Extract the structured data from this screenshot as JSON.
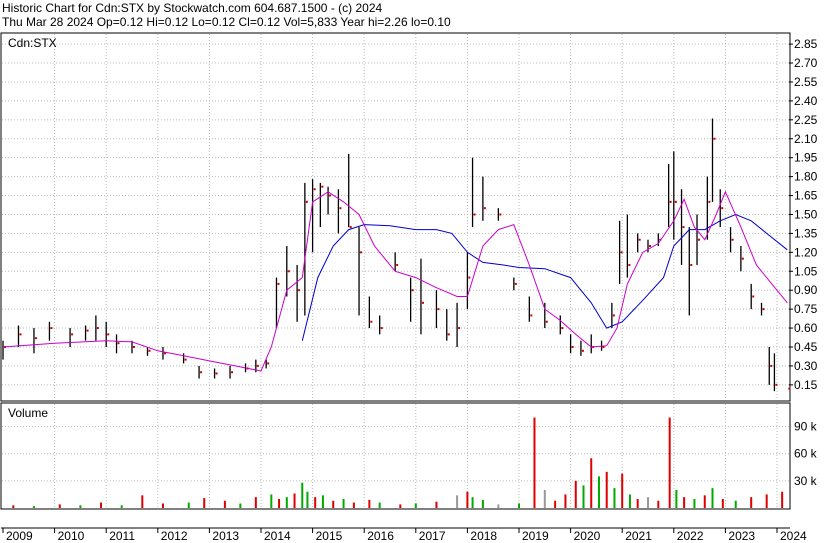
{
  "header": {
    "line1": "Historic Chart for Cdn:STX by Stockwatch.com 604.687.1500 - (c) 2024",
    "line2": "Thu Mar 28 2024  Op=0.12  Hi=0.12  Lo=0.12  Cl=0.12  Vol=5,833  Year hi=2.26  lo=0.10"
  },
  "colors": {
    "price_bar": "#000000",
    "close_dot": "#cc0000",
    "ma_short": "#cc00cc",
    "ma_long": "#0000cc",
    "vol_up": "#00aa00",
    "vol_down": "#dd0000",
    "vol_flat": "#999999"
  },
  "chart_data": {
    "type": "line",
    "symbol_label": "Cdn:STX",
    "volume_label": "Volume",
    "x_tick_labels": [
      "2009",
      "2010",
      "2011",
      "2012",
      "2013",
      "2014",
      "2015",
      "2016",
      "2017",
      "2018",
      "2019",
      "2020",
      "2021",
      "2022",
      "2023",
      "2024"
    ],
    "price_axis": {
      "min": 0.03,
      "max": 2.93,
      "ticks": [
        0.15,
        0.3,
        0.45,
        0.6,
        0.75,
        0.9,
        1.05,
        1.2,
        1.35,
        1.5,
        1.65,
        1.8,
        1.95,
        2.1,
        2.25,
        2.4,
        2.55,
        2.7,
        2.85
      ]
    },
    "volume_axis": {
      "min": 0,
      "max": 115000,
      "ticks": [
        30000,
        60000,
        90000
      ],
      "tick_labels": [
        "30 k",
        "60 k",
        "90 k"
      ]
    },
    "price_series": [
      {
        "t": 2009.0,
        "hi": 0.5,
        "lo": 0.35,
        "c": 0.45
      },
      {
        "t": 2009.3,
        "hi": 0.62,
        "lo": 0.45,
        "c": 0.55
      },
      {
        "t": 2009.6,
        "hi": 0.6,
        "lo": 0.4,
        "c": 0.52
      },
      {
        "t": 2009.9,
        "hi": 0.65,
        "lo": 0.5,
        "c": 0.6
      },
      {
        "t": 2010.3,
        "hi": 0.6,
        "lo": 0.45,
        "c": 0.55
      },
      {
        "t": 2010.6,
        "hi": 0.62,
        "lo": 0.5,
        "c": 0.58
      },
      {
        "t": 2010.8,
        "hi": 0.7,
        "lo": 0.5,
        "c": 0.6
      },
      {
        "t": 2011.0,
        "hi": 0.65,
        "lo": 0.45,
        "c": 0.55
      },
      {
        "t": 2011.2,
        "hi": 0.55,
        "lo": 0.4,
        "c": 0.48
      },
      {
        "t": 2011.5,
        "hi": 0.5,
        "lo": 0.4,
        "c": 0.45
      },
      {
        "t": 2011.8,
        "hi": 0.45,
        "lo": 0.38,
        "c": 0.42
      },
      {
        "t": 2012.1,
        "hi": 0.45,
        "lo": 0.35,
        "c": 0.4
      },
      {
        "t": 2012.5,
        "hi": 0.4,
        "lo": 0.32,
        "c": 0.35
      },
      {
        "t": 2012.8,
        "hi": 0.3,
        "lo": 0.2,
        "c": 0.25
      },
      {
        "t": 2013.1,
        "hi": 0.28,
        "lo": 0.2,
        "c": 0.24
      },
      {
        "t": 2013.4,
        "hi": 0.3,
        "lo": 0.2,
        "c": 0.25
      },
      {
        "t": 2013.7,
        "hi": 0.32,
        "lo": 0.25,
        "c": 0.28
      },
      {
        "t": 2013.9,
        "hi": 0.35,
        "lo": 0.25,
        "c": 0.3
      },
      {
        "t": 2014.1,
        "hi": 0.35,
        "lo": 0.28,
        "c": 0.32
      },
      {
        "t": 2014.3,
        "hi": 1.0,
        "lo": 0.6,
        "c": 0.95
      },
      {
        "t": 2014.5,
        "hi": 1.25,
        "lo": 0.85,
        "c": 1.05
      },
      {
        "t": 2014.7,
        "hi": 1.1,
        "lo": 0.65,
        "c": 0.9
      },
      {
        "t": 2014.85,
        "hi": 1.75,
        "lo": 0.7,
        "c": 1.6
      },
      {
        "t": 2015.0,
        "hi": 1.78,
        "lo": 1.2,
        "c": 1.7
      },
      {
        "t": 2015.15,
        "hi": 1.75,
        "lo": 1.4,
        "c": 1.72
      },
      {
        "t": 2015.3,
        "hi": 1.72,
        "lo": 1.5,
        "c": 1.65
      },
      {
        "t": 2015.5,
        "hi": 1.7,
        "lo": 1.35,
        "c": 1.55
      },
      {
        "t": 2015.7,
        "hi": 1.98,
        "lo": 1.4,
        "c": 1.4
      },
      {
        "t": 2015.9,
        "hi": 1.4,
        "lo": 0.7,
        "c": 1.2
      },
      {
        "t": 2016.1,
        "hi": 0.85,
        "lo": 0.6,
        "c": 0.65
      },
      {
        "t": 2016.3,
        "hi": 0.7,
        "lo": 0.55,
        "c": 0.6
      },
      {
        "t": 2016.6,
        "hi": 1.2,
        "lo": 1.05,
        "c": 1.1
      },
      {
        "t": 2016.9,
        "hi": 1.0,
        "lo": 0.65,
        "c": 0.9
      },
      {
        "t": 2017.1,
        "hi": 1.15,
        "lo": 0.55,
        "c": 0.8
      },
      {
        "t": 2017.4,
        "hi": 0.9,
        "lo": 0.6,
        "c": 0.75
      },
      {
        "t": 2017.6,
        "hi": 0.75,
        "lo": 0.5,
        "c": 0.55
      },
      {
        "t": 2017.8,
        "hi": 0.8,
        "lo": 0.45,
        "c": 0.6
      },
      {
        "t": 2018.0,
        "hi": 1.2,
        "lo": 0.75,
        "c": 1.0
      },
      {
        "t": 2018.1,
        "hi": 1.95,
        "lo": 1.4,
        "c": 1.5
      },
      {
        "t": 2018.3,
        "hi": 1.8,
        "lo": 1.45,
        "c": 1.55
      },
      {
        "t": 2018.6,
        "hi": 1.55,
        "lo": 1.45,
        "c": 1.5
      },
      {
        "t": 2018.9,
        "hi": 1.0,
        "lo": 0.9,
        "c": 0.95
      },
      {
        "t": 2019.2,
        "hi": 0.85,
        "lo": 0.65,
        "c": 0.7
      },
      {
        "t": 2019.5,
        "hi": 0.8,
        "lo": 0.6,
        "c": 0.65
      },
      {
        "t": 2019.8,
        "hi": 0.7,
        "lo": 0.55,
        "c": 0.6
      },
      {
        "t": 2020.0,
        "hi": 0.55,
        "lo": 0.4,
        "c": 0.45
      },
      {
        "t": 2020.2,
        "hi": 0.5,
        "lo": 0.38,
        "c": 0.42
      },
      {
        "t": 2020.4,
        "hi": 0.55,
        "lo": 0.4,
        "c": 0.45
      },
      {
        "t": 2020.6,
        "hi": 0.5,
        "lo": 0.42,
        "c": 0.45
      },
      {
        "t": 2020.8,
        "hi": 0.8,
        "lo": 0.6,
        "c": 0.7
      },
      {
        "t": 2020.95,
        "hi": 1.45,
        "lo": 0.95,
        "c": 1.2
      },
      {
        "t": 2021.1,
        "hi": 1.5,
        "lo": 1.0,
        "c": 1.1
      },
      {
        "t": 2021.3,
        "hi": 1.35,
        "lo": 1.2,
        "c": 1.3
      },
      {
        "t": 2021.5,
        "hi": 1.3,
        "lo": 1.2,
        "c": 1.25
      },
      {
        "t": 2021.7,
        "hi": 1.35,
        "lo": 1.25,
        "c": 1.3
      },
      {
        "t": 2021.9,
        "hi": 1.9,
        "lo": 1.4,
        "c": 1.6
      },
      {
        "t": 2022.0,
        "hi": 2.0,
        "lo": 1.3,
        "c": 1.6
      },
      {
        "t": 2022.15,
        "hi": 1.7,
        "lo": 1.1,
        "c": 1.4
      },
      {
        "t": 2022.3,
        "hi": 1.4,
        "lo": 0.7,
        "c": 1.1
      },
      {
        "t": 2022.45,
        "hi": 1.5,
        "lo": 1.1,
        "c": 1.3
      },
      {
        "t": 2022.65,
        "hi": 1.8,
        "lo": 1.3,
        "c": 1.6
      },
      {
        "t": 2022.75,
        "hi": 2.26,
        "lo": 1.6,
        "c": 2.1
      },
      {
        "t": 2022.9,
        "hi": 1.7,
        "lo": 1.4,
        "c": 1.55
      },
      {
        "t": 2023.1,
        "hi": 1.4,
        "lo": 1.2,
        "c": 1.3
      },
      {
        "t": 2023.3,
        "hi": 1.25,
        "lo": 1.05,
        "c": 1.15
      },
      {
        "t": 2023.5,
        "hi": 0.95,
        "lo": 0.75,
        "c": 0.85
      },
      {
        "t": 2023.7,
        "hi": 0.8,
        "lo": 0.7,
        "c": 0.75
      },
      {
        "t": 2023.85,
        "hi": 0.45,
        "lo": 0.15,
        "c": 0.3
      },
      {
        "t": 2023.95,
        "hi": 0.4,
        "lo": 0.1,
        "c": 0.15
      },
      {
        "t": 2024.2,
        "hi": 0.12,
        "lo": 0.12,
        "c": 0.12
      }
    ],
    "ma_short": [
      {
        "t": 2009.0,
        "v": 0.45
      },
      {
        "t": 2010.0,
        "v": 0.48
      },
      {
        "t": 2011.0,
        "v": 0.5
      },
      {
        "t": 2011.5,
        "v": 0.49
      },
      {
        "t": 2012.0,
        "v": 0.42
      },
      {
        "t": 2012.5,
        "v": 0.38
      },
      {
        "t": 2013.0,
        "v": 0.34
      },
      {
        "t": 2013.5,
        "v": 0.3
      },
      {
        "t": 2014.0,
        "v": 0.26
      },
      {
        "t": 2014.2,
        "v": 0.45
      },
      {
        "t": 2014.5,
        "v": 0.9
      },
      {
        "t": 2014.8,
        "v": 1.0
      },
      {
        "t": 2015.0,
        "v": 1.6
      },
      {
        "t": 2015.3,
        "v": 1.68
      },
      {
        "t": 2015.6,
        "v": 1.6
      },
      {
        "t": 2015.9,
        "v": 1.5
      },
      {
        "t": 2016.2,
        "v": 1.25
      },
      {
        "t": 2016.6,
        "v": 1.05
      },
      {
        "t": 2017.0,
        "v": 1.0
      },
      {
        "t": 2017.4,
        "v": 0.92
      },
      {
        "t": 2017.8,
        "v": 0.85
      },
      {
        "t": 2018.0,
        "v": 0.85
      },
      {
        "t": 2018.3,
        "v": 1.25
      },
      {
        "t": 2018.6,
        "v": 1.38
      },
      {
        "t": 2018.9,
        "v": 1.42
      },
      {
        "t": 2019.2,
        "v": 1.1
      },
      {
        "t": 2019.5,
        "v": 0.75
      },
      {
        "t": 2019.8,
        "v": 0.66
      },
      {
        "t": 2020.1,
        "v": 0.55
      },
      {
        "t": 2020.4,
        "v": 0.45
      },
      {
        "t": 2020.7,
        "v": 0.46
      },
      {
        "t": 2020.9,
        "v": 0.6
      },
      {
        "t": 2021.1,
        "v": 0.95
      },
      {
        "t": 2021.4,
        "v": 1.2
      },
      {
        "t": 2021.7,
        "v": 1.27
      },
      {
        "t": 2022.0,
        "v": 1.45
      },
      {
        "t": 2022.2,
        "v": 1.62
      },
      {
        "t": 2022.4,
        "v": 1.4
      },
      {
        "t": 2022.6,
        "v": 1.3
      },
      {
        "t": 2022.8,
        "v": 1.48
      },
      {
        "t": 2023.0,
        "v": 1.68
      },
      {
        "t": 2023.3,
        "v": 1.4
      },
      {
        "t": 2023.6,
        "v": 1.1
      },
      {
        "t": 2023.9,
        "v": 0.95
      },
      {
        "t": 2024.2,
        "v": 0.8
      }
    ],
    "ma_long": [
      {
        "t": 2014.8,
        "v": 0.5
      },
      {
        "t": 2015.1,
        "v": 1.0
      },
      {
        "t": 2015.4,
        "v": 1.25
      },
      {
        "t": 2015.7,
        "v": 1.38
      },
      {
        "t": 2016.0,
        "v": 1.42
      },
      {
        "t": 2016.5,
        "v": 1.41
      },
      {
        "t": 2017.0,
        "v": 1.38
      },
      {
        "t": 2017.4,
        "v": 1.38
      },
      {
        "t": 2017.7,
        "v": 1.35
      },
      {
        "t": 2018.0,
        "v": 1.2
      },
      {
        "t": 2018.3,
        "v": 1.12
      },
      {
        "t": 2018.7,
        "v": 1.1
      },
      {
        "t": 2019.0,
        "v": 1.08
      },
      {
        "t": 2019.5,
        "v": 1.07
      },
      {
        "t": 2020.0,
        "v": 1.0
      },
      {
        "t": 2020.4,
        "v": 0.8
      },
      {
        "t": 2020.7,
        "v": 0.6
      },
      {
        "t": 2021.0,
        "v": 0.65
      },
      {
        "t": 2021.4,
        "v": 0.82
      },
      {
        "t": 2021.8,
        "v": 1.0
      },
      {
        "t": 2022.0,
        "v": 1.25
      },
      {
        "t": 2022.3,
        "v": 1.38
      },
      {
        "t": 2022.6,
        "v": 1.38
      },
      {
        "t": 2022.9,
        "v": 1.45
      },
      {
        "t": 2023.2,
        "v": 1.5
      },
      {
        "t": 2023.5,
        "v": 1.45
      },
      {
        "t": 2023.8,
        "v": 1.35
      },
      {
        "t": 2024.2,
        "v": 1.22
      }
    ],
    "volume_series": [
      {
        "t": 2009.2,
        "v": 3000,
        "d": "down"
      },
      {
        "t": 2009.6,
        "v": 2000,
        "d": "up"
      },
      {
        "t": 2010.1,
        "v": 4000,
        "d": "down"
      },
      {
        "t": 2010.5,
        "v": 3000,
        "d": "up"
      },
      {
        "t": 2010.9,
        "v": 6000,
        "d": "down"
      },
      {
        "t": 2011.3,
        "v": 3000,
        "d": "up"
      },
      {
        "t": 2011.7,
        "v": 14000,
        "d": "down"
      },
      {
        "t": 2012.1,
        "v": 5000,
        "d": "down"
      },
      {
        "t": 2012.6,
        "v": 6000,
        "d": "up"
      },
      {
        "t": 2012.9,
        "v": 11000,
        "d": "down"
      },
      {
        "t": 2013.3,
        "v": 8000,
        "d": "down"
      },
      {
        "t": 2013.6,
        "v": 5000,
        "d": "up"
      },
      {
        "t": 2013.9,
        "v": 12000,
        "d": "down"
      },
      {
        "t": 2014.2,
        "v": 15000,
        "d": "up"
      },
      {
        "t": 2014.35,
        "v": 10000,
        "d": "down"
      },
      {
        "t": 2014.5,
        "v": 12000,
        "d": "up"
      },
      {
        "t": 2014.65,
        "v": 16000,
        "d": "down"
      },
      {
        "t": 2014.8,
        "v": 28000,
        "d": "up"
      },
      {
        "t": 2014.9,
        "v": 18000,
        "d": "up"
      },
      {
        "t": 2015.05,
        "v": 12000,
        "d": "down"
      },
      {
        "t": 2015.2,
        "v": 14000,
        "d": "up"
      },
      {
        "t": 2015.4,
        "v": 8000,
        "d": "down"
      },
      {
        "t": 2015.6,
        "v": 10000,
        "d": "up"
      },
      {
        "t": 2015.8,
        "v": 6000,
        "d": "down"
      },
      {
        "t": 2016.1,
        "v": 9000,
        "d": "down"
      },
      {
        "t": 2016.3,
        "v": 6000,
        "d": "up"
      },
      {
        "t": 2016.7,
        "v": 4000,
        "d": "down"
      },
      {
        "t": 2017.0,
        "v": 5000,
        "d": "up"
      },
      {
        "t": 2017.4,
        "v": 7000,
        "d": "down"
      },
      {
        "t": 2017.8,
        "v": 14000,
        "d": "flat"
      },
      {
        "t": 2018.0,
        "v": 18000,
        "d": "down"
      },
      {
        "t": 2018.1,
        "v": 12000,
        "d": "up"
      },
      {
        "t": 2018.3,
        "v": 9000,
        "d": "up"
      },
      {
        "t": 2018.6,
        "v": 4000,
        "d": "flat"
      },
      {
        "t": 2019.0,
        "v": 5000,
        "d": "up"
      },
      {
        "t": 2019.3,
        "v": 100000,
        "d": "down"
      },
      {
        "t": 2019.5,
        "v": 20000,
        "d": "flat"
      },
      {
        "t": 2019.7,
        "v": 8000,
        "d": "down"
      },
      {
        "t": 2019.9,
        "v": 15000,
        "d": "down"
      },
      {
        "t": 2020.1,
        "v": 30000,
        "d": "down"
      },
      {
        "t": 2020.25,
        "v": 25000,
        "d": "up"
      },
      {
        "t": 2020.4,
        "v": 55000,
        "d": "down"
      },
      {
        "t": 2020.55,
        "v": 35000,
        "d": "up"
      },
      {
        "t": 2020.7,
        "v": 40000,
        "d": "down"
      },
      {
        "t": 2020.85,
        "v": 22000,
        "d": "up"
      },
      {
        "t": 2021.0,
        "v": 38000,
        "d": "down"
      },
      {
        "t": 2021.15,
        "v": 15000,
        "d": "up"
      },
      {
        "t": 2021.3,
        "v": 10000,
        "d": "down"
      },
      {
        "t": 2021.5,
        "v": 12000,
        "d": "flat"
      },
      {
        "t": 2021.7,
        "v": 8000,
        "d": "down"
      },
      {
        "t": 2021.92,
        "v": 100000,
        "d": "down"
      },
      {
        "t": 2022.05,
        "v": 20000,
        "d": "up"
      },
      {
        "t": 2022.2,
        "v": 12000,
        "d": "down"
      },
      {
        "t": 2022.4,
        "v": 10000,
        "d": "up"
      },
      {
        "t": 2022.6,
        "v": 14000,
        "d": "down"
      },
      {
        "t": 2022.75,
        "v": 22000,
        "d": "up"
      },
      {
        "t": 2022.95,
        "v": 10000,
        "d": "down"
      },
      {
        "t": 2023.2,
        "v": 8000,
        "d": "up"
      },
      {
        "t": 2023.5,
        "v": 12000,
        "d": "down"
      },
      {
        "t": 2023.8,
        "v": 15000,
        "d": "down"
      },
      {
        "t": 2024.1,
        "v": 18000,
        "d": "down"
      }
    ]
  }
}
